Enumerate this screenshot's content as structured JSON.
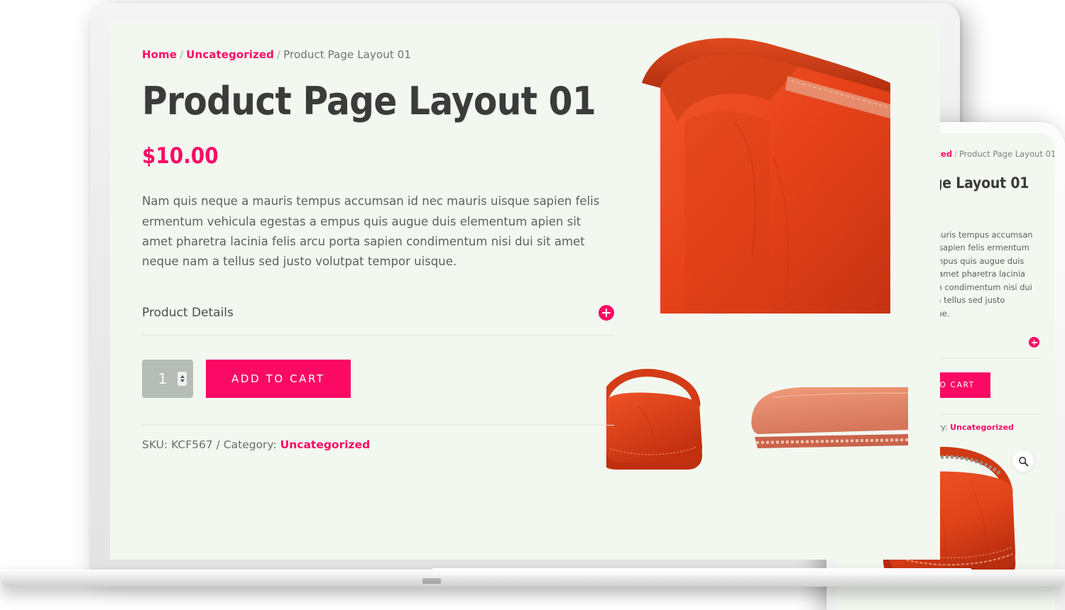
{
  "device_mockup": {
    "laptop_label": "laptop-mockup",
    "phone_label": "phone-mockup"
  },
  "breadcrumb": {
    "home": "Home",
    "category": "Uncategorized",
    "current": "Product Page Layout 01",
    "separator": "/"
  },
  "product": {
    "title": "Product Page Layout 01",
    "price": "$10.00",
    "description": "Nam quis neque a mauris tempus accumsan id nec mauris uisque sapien felis ermentum vehicula egestas a empus quis augue duis elementum apien sit amet pharetra lacinia felis arcu porta sapien condimentum nisi dui sit amet neque nam a tellus sed justo volutpat tempor uisque.",
    "accordion_label": "Product Details",
    "quantity_value": "1",
    "add_to_cart_label": "ADD TO CART",
    "sku_prefix": "SKU: KCF567 / Category:",
    "sku_code": "KCF567",
    "category_link": "Uncategorized"
  },
  "icons": {
    "plus": "plus-icon",
    "magnifier": "magnifier-icon",
    "spinner_up": "chevron-up-icon",
    "spinner_down": "chevron-down-icon"
  },
  "colors": {
    "accent_pink": "#fa0a64",
    "page_background": "#f2f8f0",
    "text_dark": "#3b3b3b",
    "text_body": "#5d625c",
    "qty_gray": "#b6bdb6",
    "bag_orange": "#e8431a",
    "pouch_peach": "#ea8a6c"
  },
  "imagery": {
    "hero_bag_alt": "orange-leather-handbag-large",
    "small_bag_alt": "orange-leather-handbag-small",
    "pouch_alt": "peach-leather-pouch",
    "phone_bag_alt": "orange-leather-handbag-phone"
  }
}
